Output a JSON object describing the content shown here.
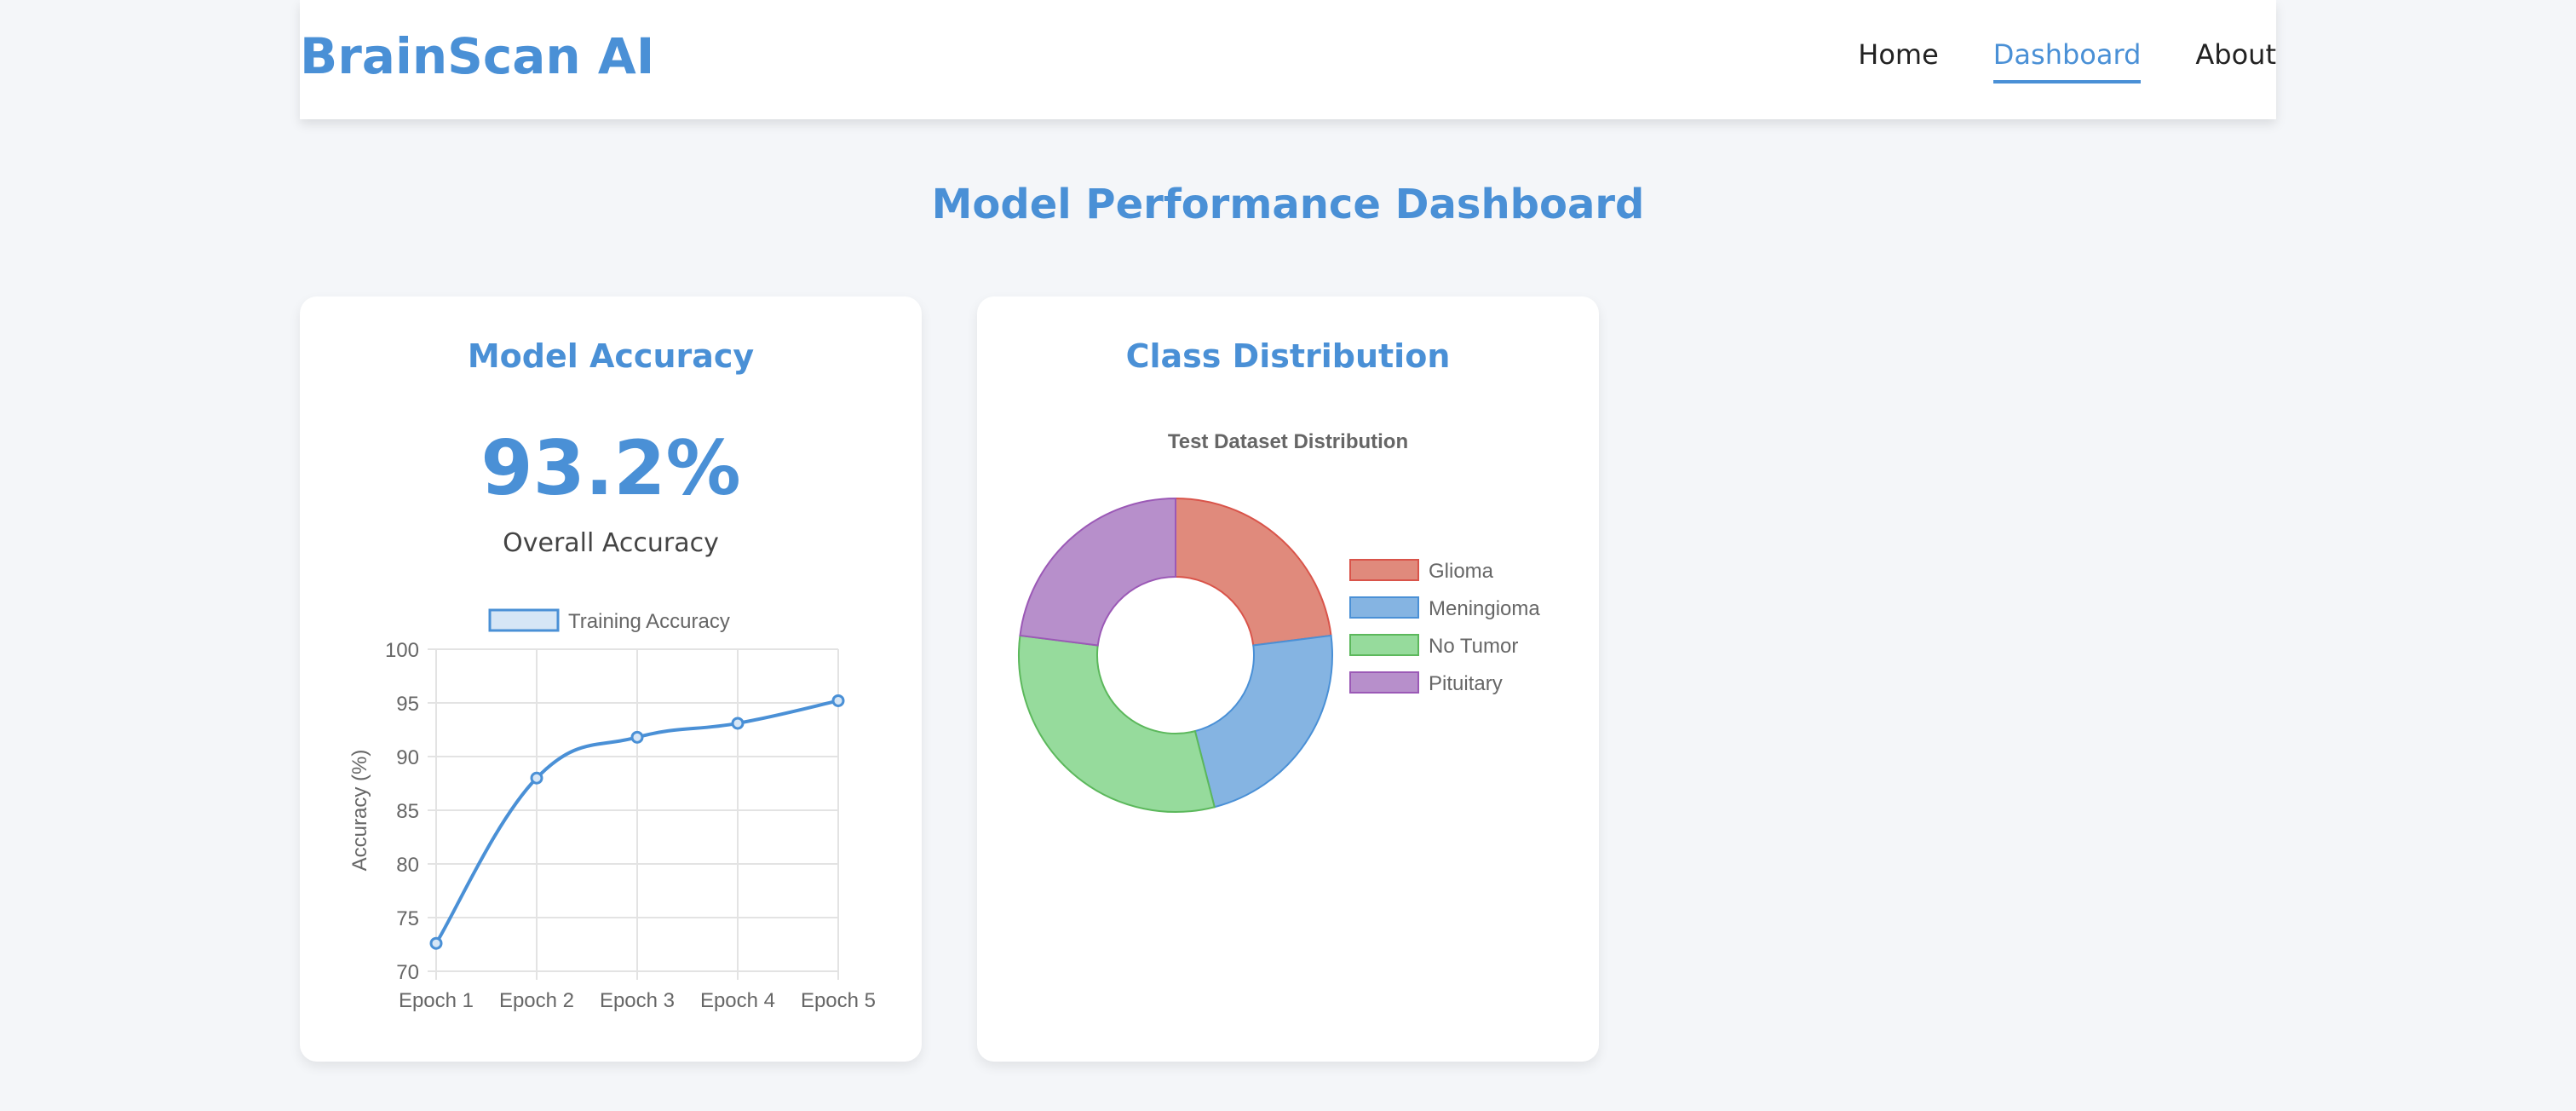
{
  "header": {
    "brand": "BrainScan AI",
    "nav": [
      {
        "label": "Home",
        "active": false
      },
      {
        "label": "Dashboard",
        "active": true
      },
      {
        "label": "About",
        "active": false
      }
    ]
  },
  "page": {
    "title": "Model Performance Dashboard"
  },
  "accuracy_card": {
    "title": "Model Accuracy",
    "value": "93.2%",
    "caption": "Overall Accuracy"
  },
  "distribution_card": {
    "title": "Class Distribution"
  },
  "colors": {
    "accent": "#4a90d6",
    "glioma": "#e08a7c",
    "meningioma": "#85b4e2",
    "no_tumor": "#96db9c",
    "pituitary": "#b78fcb"
  },
  "chart_data": [
    {
      "type": "line",
      "title": "",
      "categories": [
        "Epoch 1",
        "Epoch 2",
        "Epoch 3",
        "Epoch 4",
        "Epoch 5"
      ],
      "series": [
        {
          "name": "Training Accuracy",
          "values": [
            72.6,
            88.0,
            91.8,
            93.1,
            95.2
          ],
          "color": "#4a90d6"
        }
      ],
      "xlabel": "",
      "ylabel": "Accuracy (%)",
      "ylim": [
        70,
        100
      ],
      "yticks": [
        100,
        95,
        90,
        85,
        80,
        75,
        70
      ],
      "grid": true,
      "legend": "top"
    },
    {
      "type": "pie",
      "variant": "doughnut",
      "title": "Test Dataset Distribution",
      "categories": [
        "Glioma",
        "Meningioma",
        "No Tumor",
        "Pituitary"
      ],
      "values": [
        23,
        23,
        31,
        23
      ],
      "colors": [
        "#e08a7c",
        "#85b4e2",
        "#96db9c",
        "#b78fcb"
      ],
      "borders": [
        "#d9544a",
        "#4a90d6",
        "#5cb85c",
        "#9b59b6"
      ],
      "legend": "right"
    }
  ]
}
